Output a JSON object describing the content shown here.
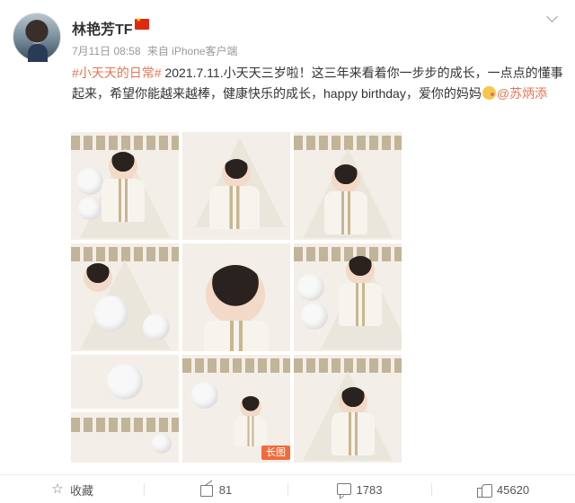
{
  "user": {
    "name": "林艳芳TF",
    "flag": "china-flag-icon"
  },
  "meta": {
    "time": "7月11日 08:58",
    "source": "来自 iPhone客户端"
  },
  "post": {
    "topic": "#小天天的日常#",
    "text": " 2021.7.11.小天天三岁啦！这三年来看着你一步步的成长，一点点的懂事起来，希望你能越来越棒，健康快乐的成长，happy birthday，爱你的妈妈",
    "emoji": "kiss-emoji-icon",
    "mention": "@苏炳添",
    "long_image_badge": "长图"
  },
  "photos": [
    {
      "name": "photo-1"
    },
    {
      "name": "photo-2"
    },
    {
      "name": "photo-3"
    },
    {
      "name": "photo-4"
    },
    {
      "name": "photo-5"
    },
    {
      "name": "photo-6"
    },
    {
      "name": "photo-7"
    },
    {
      "name": "photo-8"
    },
    {
      "name": "photo-9"
    }
  ],
  "actions": {
    "favorite_label": "收藏",
    "share_count": "81",
    "comment_count": "1783",
    "like_count": "45620"
  },
  "colors": {
    "link": "#eb7350",
    "badge": "#f26b3a"
  }
}
